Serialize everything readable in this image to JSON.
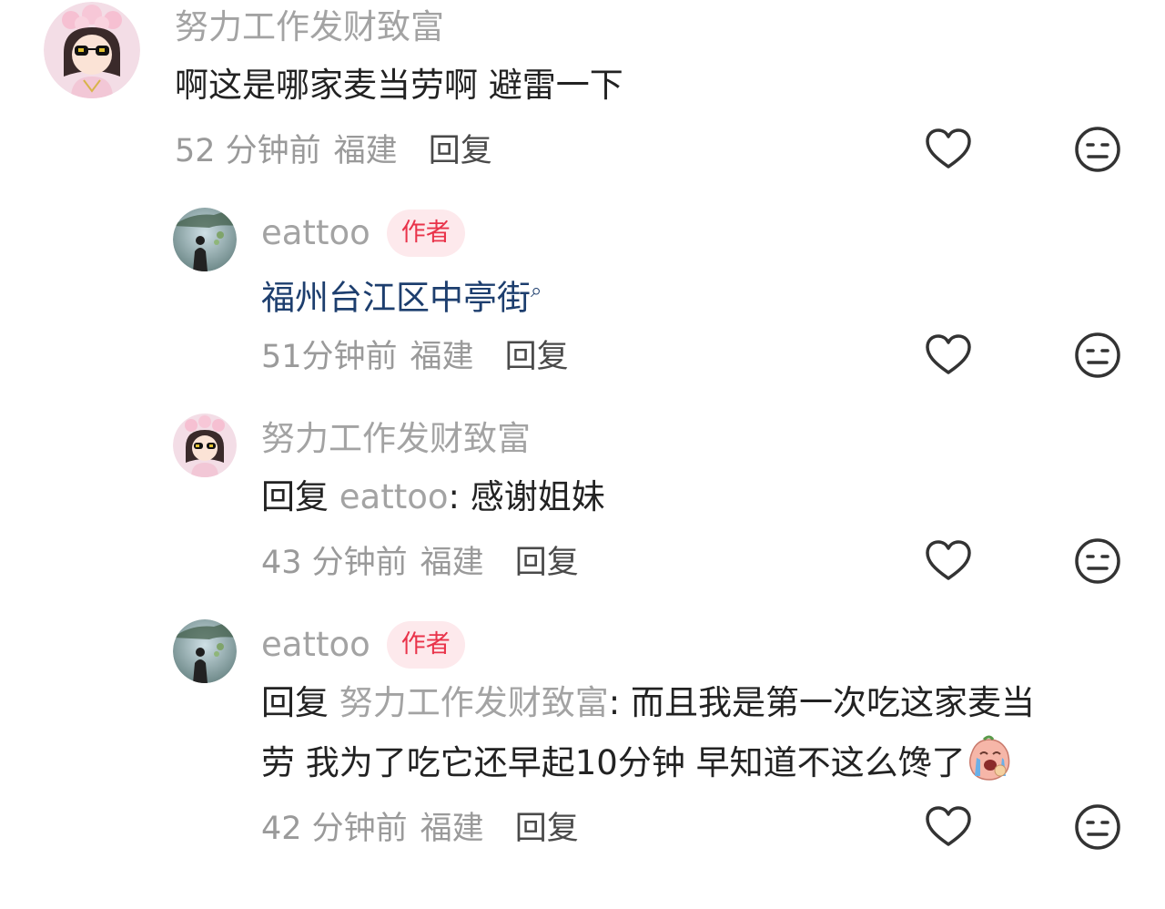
{
  "comments": [
    {
      "username": "努力工作发财致富",
      "content": "啊这是哪家麦当劳啊 避雷一下",
      "time": "52 分钟前",
      "location": "福建",
      "reply_label": "回复"
    },
    {
      "username": "eattoo",
      "badge": "作者",
      "content_link": "福州台江区中亭街",
      "time": "51分钟前",
      "location": "福建",
      "reply_label": "回复"
    },
    {
      "username": "努力工作发财致富",
      "reply_prefix": "回复 ",
      "reply_target": "eattoo",
      "content": ": 感谢姐妹",
      "time": "43 分钟前",
      "location": "福建",
      "reply_label": "回复"
    },
    {
      "username": "eattoo",
      "badge": "作者",
      "reply_prefix": "回复 ",
      "reply_target": "努力工作发财致富",
      "content_line1": ": 而且我是第一次吃这家麦当",
      "content_line2": "劳 我为了吃它还早起10分钟 早知道不这么馋了",
      "time": "42 分钟前",
      "location": "福建",
      "reply_label": "回复"
    }
  ],
  "icons": {
    "like": "heart-outline-icon",
    "dislike": "meh-face-icon",
    "emoji": "crying-face-emoji",
    "search": "magnifier-icon"
  },
  "colors": {
    "username": "#a3a3a3",
    "badge_bg": "#fde9ec",
    "badge_text": "#e9334a",
    "link": "#1d3e6e"
  }
}
